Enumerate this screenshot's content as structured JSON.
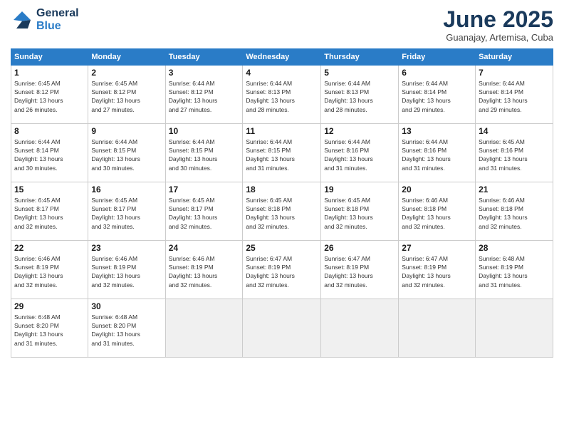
{
  "logo": {
    "line1": "General",
    "line2": "Blue"
  },
  "title": "June 2025",
  "subtitle": "Guanajay, Artemisa, Cuba",
  "days_header": [
    "Sunday",
    "Monday",
    "Tuesday",
    "Wednesday",
    "Thursday",
    "Friday",
    "Saturday"
  ],
  "weeks": [
    [
      {
        "day": "1",
        "sunrise": "6:45 AM",
        "sunset": "8:12 PM",
        "daylight": "13 hours and 26 minutes."
      },
      {
        "day": "2",
        "sunrise": "6:45 AM",
        "sunset": "8:12 PM",
        "daylight": "13 hours and 27 minutes."
      },
      {
        "day": "3",
        "sunrise": "6:44 AM",
        "sunset": "8:12 PM",
        "daylight": "13 hours and 27 minutes."
      },
      {
        "day": "4",
        "sunrise": "6:44 AM",
        "sunset": "8:13 PM",
        "daylight": "13 hours and 28 minutes."
      },
      {
        "day": "5",
        "sunrise": "6:44 AM",
        "sunset": "8:13 PM",
        "daylight": "13 hours and 28 minutes."
      },
      {
        "day": "6",
        "sunrise": "6:44 AM",
        "sunset": "8:14 PM",
        "daylight": "13 hours and 29 minutes."
      },
      {
        "day": "7",
        "sunrise": "6:44 AM",
        "sunset": "8:14 PM",
        "daylight": "13 hours and 29 minutes."
      }
    ],
    [
      {
        "day": "8",
        "sunrise": "6:44 AM",
        "sunset": "8:14 PM",
        "daylight": "13 hours and 30 minutes."
      },
      {
        "day": "9",
        "sunrise": "6:44 AM",
        "sunset": "8:15 PM",
        "daylight": "13 hours and 30 minutes."
      },
      {
        "day": "10",
        "sunrise": "6:44 AM",
        "sunset": "8:15 PM",
        "daylight": "13 hours and 30 minutes."
      },
      {
        "day": "11",
        "sunrise": "6:44 AM",
        "sunset": "8:15 PM",
        "daylight": "13 hours and 31 minutes."
      },
      {
        "day": "12",
        "sunrise": "6:44 AM",
        "sunset": "8:16 PM",
        "daylight": "13 hours and 31 minutes."
      },
      {
        "day": "13",
        "sunrise": "6:44 AM",
        "sunset": "8:16 PM",
        "daylight": "13 hours and 31 minutes."
      },
      {
        "day": "14",
        "sunrise": "6:45 AM",
        "sunset": "8:16 PM",
        "daylight": "13 hours and 31 minutes."
      }
    ],
    [
      {
        "day": "15",
        "sunrise": "6:45 AM",
        "sunset": "8:17 PM",
        "daylight": "13 hours and 32 minutes."
      },
      {
        "day": "16",
        "sunrise": "6:45 AM",
        "sunset": "8:17 PM",
        "daylight": "13 hours and 32 minutes."
      },
      {
        "day": "17",
        "sunrise": "6:45 AM",
        "sunset": "8:17 PM",
        "daylight": "13 hours and 32 minutes."
      },
      {
        "day": "18",
        "sunrise": "6:45 AM",
        "sunset": "8:18 PM",
        "daylight": "13 hours and 32 minutes."
      },
      {
        "day": "19",
        "sunrise": "6:45 AM",
        "sunset": "8:18 PM",
        "daylight": "13 hours and 32 minutes."
      },
      {
        "day": "20",
        "sunrise": "6:46 AM",
        "sunset": "8:18 PM",
        "daylight": "13 hours and 32 minutes."
      },
      {
        "day": "21",
        "sunrise": "6:46 AM",
        "sunset": "8:18 PM",
        "daylight": "13 hours and 32 minutes."
      }
    ],
    [
      {
        "day": "22",
        "sunrise": "6:46 AM",
        "sunset": "8:19 PM",
        "daylight": "13 hours and 32 minutes."
      },
      {
        "day": "23",
        "sunrise": "6:46 AM",
        "sunset": "8:19 PM",
        "daylight": "13 hours and 32 minutes."
      },
      {
        "day": "24",
        "sunrise": "6:46 AM",
        "sunset": "8:19 PM",
        "daylight": "13 hours and 32 minutes."
      },
      {
        "day": "25",
        "sunrise": "6:47 AM",
        "sunset": "8:19 PM",
        "daylight": "13 hours and 32 minutes."
      },
      {
        "day": "26",
        "sunrise": "6:47 AM",
        "sunset": "8:19 PM",
        "daylight": "13 hours and 32 minutes."
      },
      {
        "day": "27",
        "sunrise": "6:47 AM",
        "sunset": "8:19 PM",
        "daylight": "13 hours and 32 minutes."
      },
      {
        "day": "28",
        "sunrise": "6:48 AM",
        "sunset": "8:19 PM",
        "daylight": "13 hours and 31 minutes."
      }
    ],
    [
      {
        "day": "29",
        "sunrise": "6:48 AM",
        "sunset": "8:20 PM",
        "daylight": "13 hours and 31 minutes."
      },
      {
        "day": "30",
        "sunrise": "6:48 AM",
        "sunset": "8:20 PM",
        "daylight": "13 hours and 31 minutes."
      },
      null,
      null,
      null,
      null,
      null
    ]
  ]
}
